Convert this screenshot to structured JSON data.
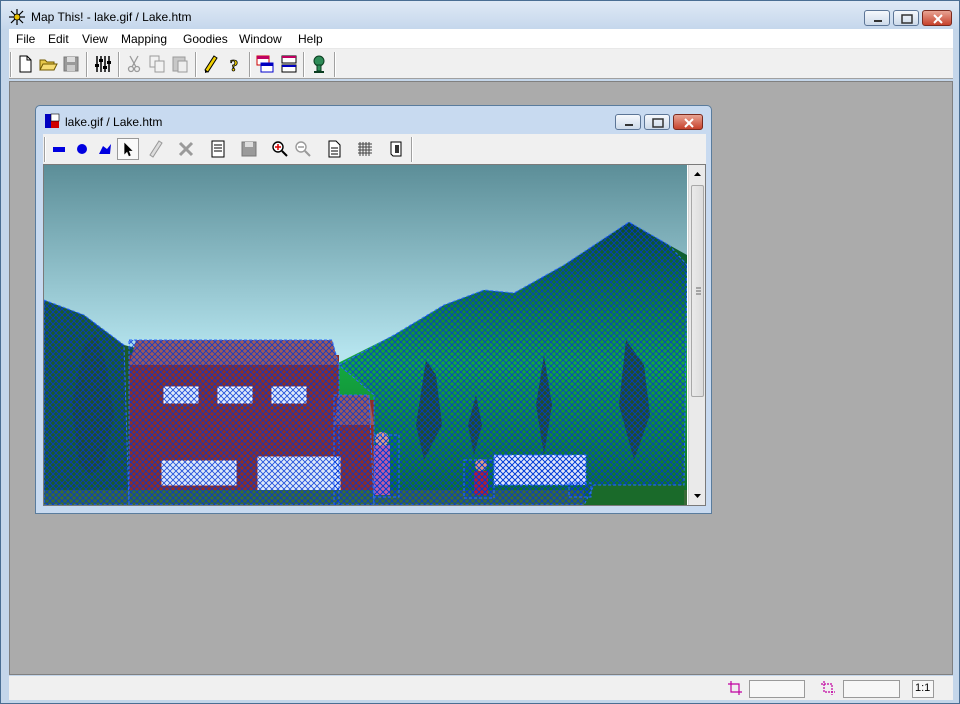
{
  "window": {
    "title": "Map This! - lake.gif / Lake.htm"
  },
  "menu": [
    "File",
    "Edit",
    "View",
    "Mapping",
    "Goodies",
    "Window",
    "Help"
  ],
  "toolbar": {
    "buttons": [
      {
        "name": "new-icon",
        "label": "New"
      },
      {
        "name": "open-folder-icon",
        "label": "Open"
      },
      {
        "name": "save-icon",
        "label": "Save"
      },
      {
        "name": "settings-sliders-icon",
        "label": "Preferences"
      },
      {
        "name": "cut-icon",
        "label": "Cut"
      },
      {
        "name": "copy-icon",
        "label": "Copy"
      },
      {
        "name": "paste-icon",
        "label": "Paste"
      },
      {
        "name": "pencil-icon",
        "label": "Edit"
      },
      {
        "name": "help-question-icon",
        "label": "Help"
      },
      {
        "name": "cascade-windows-icon",
        "label": "Cascade"
      },
      {
        "name": "tile-windows-icon",
        "label": "Tile"
      },
      {
        "name": "map-pin-icon",
        "label": "Test"
      }
    ]
  },
  "child": {
    "title": "lake.gif / Lake.htm",
    "toolbar": [
      {
        "name": "rectangle-tool-icon"
      },
      {
        "name": "circle-tool-icon"
      },
      {
        "name": "polygon-tool-icon"
      },
      {
        "name": "pointer-tool-icon"
      },
      {
        "name": "edit-area-icon"
      },
      {
        "name": "delete-area-icon"
      },
      {
        "name": "area-properties-icon"
      },
      {
        "name": "save-map-icon"
      },
      {
        "name": "zoom-in-icon"
      },
      {
        "name": "zoom-out-icon"
      },
      {
        "name": "document-icon"
      },
      {
        "name": "grid-icon"
      },
      {
        "name": "map-info-icon"
      }
    ]
  },
  "statusbar": {
    "zoom": "1:1",
    "position": "",
    "size": ""
  },
  "colors": {
    "mdi_background": "#ababab",
    "titlebar": "#c5d7ec",
    "sky_top": "#5c8e98",
    "sky_bottom": "#c4ecf6",
    "hatch": "#0040ff"
  }
}
